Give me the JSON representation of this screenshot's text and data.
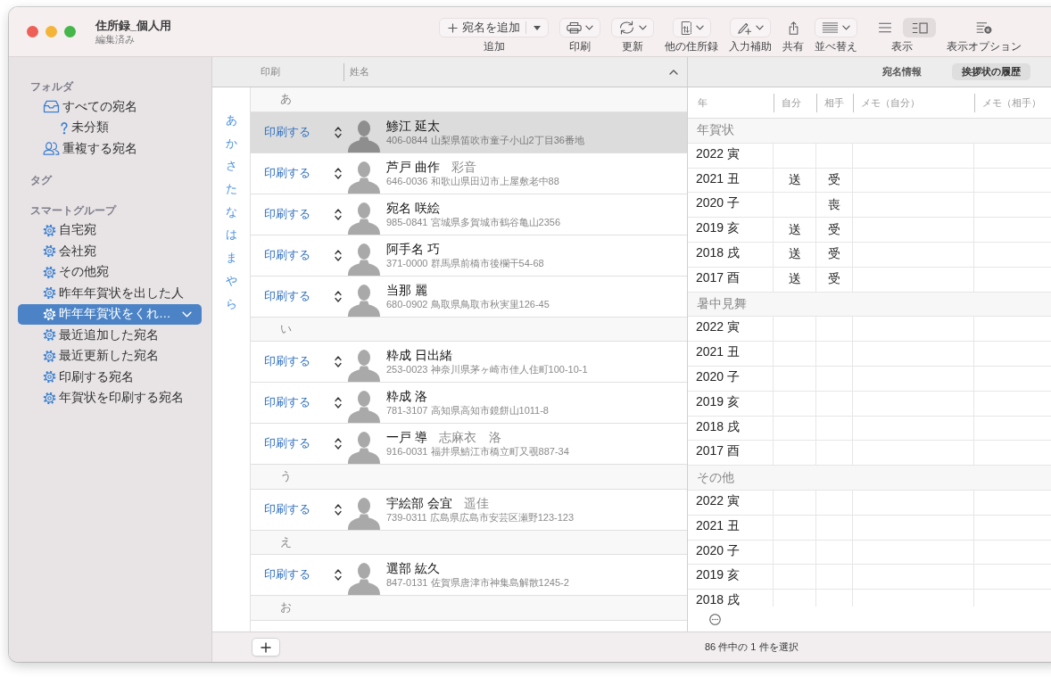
{
  "window": {
    "title": "住所録_個人用",
    "subtitle": "編集済み"
  },
  "toolbar": [
    {
      "kind": "split",
      "text": "宛名を追加",
      "label": "追加"
    },
    {
      "kind": "menu",
      "label": "印刷"
    },
    {
      "kind": "menu",
      "label": "更新"
    },
    {
      "kind": "menu",
      "label": "他の住所録"
    },
    {
      "kind": "menu",
      "label": "入力補助"
    },
    {
      "kind": "plain",
      "label": "共有"
    },
    {
      "kind": "menu",
      "label": "並べ替え"
    },
    {
      "kind": "segmented",
      "label": "表示",
      "segments": [
        {
          "selected": false
        },
        {
          "selected": true
        }
      ]
    },
    {
      "kind": "plain",
      "label": "表示オプション"
    }
  ],
  "sidebar": {
    "sections": [
      {
        "title": "フォルダ",
        "items": [
          {
            "kind": "all",
            "label": "すべての宛名",
            "selected": false,
            "children": [
              {
                "kind": "unfiled",
                "label": "未分類",
                "selected": false
              }
            ]
          },
          {
            "kind": "duplicates",
            "label": "重複する宛名",
            "selected": false
          }
        ]
      },
      {
        "title": "タグ"
      },
      {
        "title": "スマートグループ",
        "items": [
          {
            "kind": "smart",
            "label": "自宅宛",
            "selected": false
          },
          {
            "kind": "smart",
            "label": "会社宛",
            "selected": false
          },
          {
            "kind": "smart",
            "label": "その他宛",
            "selected": false
          },
          {
            "kind": "smart",
            "label": "昨年年賀状を出した人",
            "selected": false
          },
          {
            "kind": "smart",
            "label": "昨年年賀状をくれ…",
            "selected": true
          },
          {
            "kind": "smart",
            "label": "最近追加した宛名",
            "selected": false
          },
          {
            "kind": "smart",
            "label": "最近更新した宛名",
            "selected": false
          },
          {
            "kind": "smart",
            "label": "印刷する宛名",
            "selected": false
          },
          {
            "kind": "smart",
            "label": "年賀状を印刷する宛名",
            "selected": false
          }
        ]
      }
    ]
  },
  "index_letters": [
    "あ",
    "か",
    "さ",
    "た",
    "な",
    "は",
    "ま",
    "や",
    "ら"
  ],
  "list": {
    "columns": [
      "印刷",
      "姓名"
    ],
    "sort_ascending": true,
    "sections": [
      {
        "heading": "あ",
        "contacts": [
          {
            "print": "印刷する",
            "name": "鯵江 延太",
            "address": "406-0844 山梨県笛吹市童子小山2丁目36番地",
            "selected": true
          },
          {
            "print": "印刷する",
            "name": "芦戸 曲作",
            "joint_name": "彩音",
            "address": "646-0036 和歌山県田辺市上屋敷老中88",
            "selected": false
          },
          {
            "print": "印刷する",
            "name": "宛名 咲絵",
            "address": "985-0841 宮城県多賀城市鶴谷亀山2356",
            "selected": false
          },
          {
            "print": "印刷する",
            "name": "阿手名 巧",
            "address": "371-0000 群馬県前橋市後欄干54-68",
            "selected": false
          },
          {
            "print": "印刷する",
            "name": "当那 麗",
            "address": "680-0902 鳥取県鳥取市秋実里126-45",
            "selected": false
          }
        ]
      },
      {
        "heading": "い",
        "contacts": [
          {
            "print": "印刷する",
            "name": "粋成 日出緒",
            "address": "253-0023 神奈川県茅ヶ崎市佳人住町100-10-1",
            "selected": false
          },
          {
            "print": "印刷する",
            "name": "粋成 洛",
            "address": "781-3107 高知県高知市鏡餅山1011-8",
            "selected": false
          },
          {
            "print": "印刷する",
            "name": "一戸 導",
            "joint_name": "志麻衣　洛",
            "address": "916-0031 福井県鯖江市橋立町又覗887-34",
            "selected": false
          }
        ]
      },
      {
        "heading": "う",
        "contacts": [
          {
            "print": "印刷する",
            "name": "宇絵部 会宜",
            "joint_name": "遥佳",
            "address": "739-0311 広島県広島市安芸区瀬野123-123",
            "selected": false
          }
        ]
      },
      {
        "heading": "え",
        "contacts": [
          {
            "print": "印刷する",
            "name": "選部 紘久",
            "address": "847-0131 佐賀県唐津市神集島解散1245-2",
            "selected": false
          }
        ]
      },
      {
        "heading": "お"
      }
    ]
  },
  "detail": {
    "tabs": [
      {
        "label": "宛名情報",
        "selected": false
      },
      {
        "label": "挨拶状の履歴",
        "selected": true
      }
    ],
    "columns": [
      "年",
      "自分",
      "相手",
      "メモ（自分）",
      "メモ（相手）"
    ],
    "sections": [
      {
        "title": "年賀状",
        "rows": [
          {
            "year": "2022 寅"
          },
          {
            "year": "2021 丑",
            "self": "送",
            "other": "受"
          },
          {
            "year": "2020 子",
            "other": "喪"
          },
          {
            "year": "2019 亥",
            "self": "送",
            "other": "受"
          },
          {
            "year": "2018 戌",
            "self": "送",
            "other": "受"
          },
          {
            "year": "2017 酉",
            "self": "送",
            "other": "受"
          }
        ]
      },
      {
        "title": "暑中見舞",
        "rows": [
          {
            "year": "2022 寅"
          },
          {
            "year": "2021 丑"
          },
          {
            "year": "2020 子"
          },
          {
            "year": "2019 亥"
          },
          {
            "year": "2018 戌"
          },
          {
            "year": "2017 酉"
          }
        ]
      },
      {
        "title": "その他",
        "rows": [
          {
            "year": "2022 寅"
          },
          {
            "year": "2021 丑"
          },
          {
            "year": "2020 子"
          },
          {
            "year": "2019 亥"
          },
          {
            "year": "2018 戌"
          }
        ]
      }
    ]
  },
  "status_bar": {
    "text": "86 件中の 1 件を選択"
  }
}
